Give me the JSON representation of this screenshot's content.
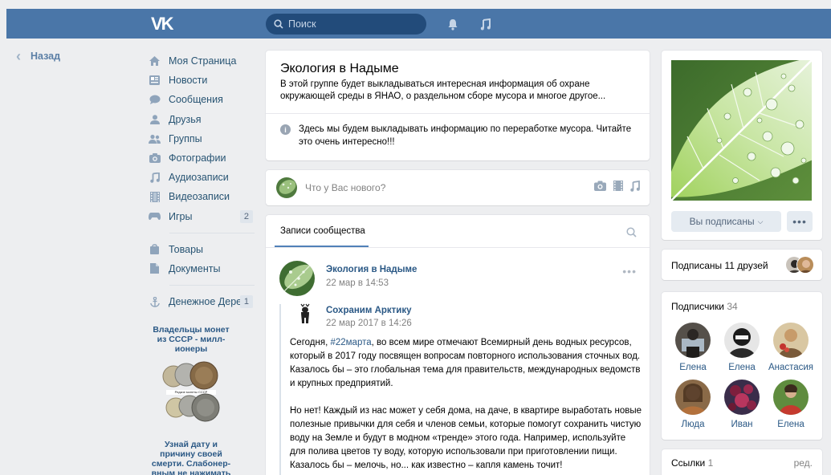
{
  "header": {
    "logo_text": "VK",
    "search_placeholder": "Поиск"
  },
  "back": {
    "label": "Назад"
  },
  "menu": {
    "items": [
      {
        "label": "Моя Страница",
        "icon": "home-icon"
      },
      {
        "label": "Новости",
        "icon": "news-icon"
      },
      {
        "label": "Сообщения",
        "icon": "messages-icon"
      },
      {
        "label": "Друзья",
        "icon": "friends-icon"
      },
      {
        "label": "Группы",
        "icon": "groups-icon"
      },
      {
        "label": "Фотографии",
        "icon": "camera-icon"
      },
      {
        "label": "Аудиозаписи",
        "icon": "music-icon"
      },
      {
        "label": "Видеозаписи",
        "icon": "film-icon"
      },
      {
        "label": "Игры",
        "icon": "gamepad-icon",
        "badge": "2"
      }
    ],
    "items2": [
      {
        "label": "Товары",
        "icon": "bag-icon"
      },
      {
        "label": "Документы",
        "icon": "document-icon"
      }
    ],
    "items3": [
      {
        "label": "Денежное Дере...",
        "icon": "anchor-icon",
        "badge": "1"
      }
    ]
  },
  "ads": {
    "ad1_title": "Владельцы монет из СССР - милл-ионеры",
    "ad1_caption": "Редкие монеты СССР",
    "ad2_title": "Узнай дату и причину своей смерти. Слабонер-вным не нажимать"
  },
  "group": {
    "title": "Экология в Надыме",
    "description": "В этой группе будет выкладываться интересная информация об охране окружающей среды в ЯНАО, о раздельном сборе мусора и многое другое...",
    "info": "Здесь мы будем выкладывать информацию по переработке мусора. Читайте это очень интересно!!!"
  },
  "composer": {
    "placeholder": "Что у Вас нового?"
  },
  "wall": {
    "tab_label": "Записи сообщества",
    "post": {
      "author": "Экология в Надыме",
      "date": "22 мар в 14:53",
      "repost_author": "Сохраним Арктику",
      "repost_date": "22 мар 2017 в 14:26",
      "p1_before": "Сегодня, ",
      "p1_tag": "#22марта",
      "p1_after": ", во всем мире отмечают Всемирный день водных ресурсов, который в 2017 году посвящен вопросам повторного использования сточных вод. Казалось бы – это глобальная тема для правительств, международных ведомств и крупных предприятий.",
      "p2": "Но нет! Каждый из нас может у себя дома, на даче, в квартире выработать новые полезные привычки для себя и членов семьи, которые помогут сохранить чистую воду на Земле и будут в модном «тренде» этого года. Например, используйте для полива цветов ту воду, которую использовали при приготовлении пищи. Казалось бы – мелочь, но... как известно – капля камень точит!"
    }
  },
  "right": {
    "subscribed_button": "Вы подписаны",
    "more_button": "•••",
    "friends_label": "Подписаны 11 друзей",
    "subs_title": "Подписчики",
    "subs_count": "34",
    "members": [
      {
        "name": "Елена"
      },
      {
        "name": "Елена"
      },
      {
        "name": "Анастасия"
      },
      {
        "name": "Люда"
      },
      {
        "name": "Иван"
      },
      {
        "name": "Елена"
      }
    ],
    "links_title": "Ссылки",
    "links_count": "1",
    "links_edit": "ред."
  },
  "colors": {
    "header": "#4a76a8",
    "link": "#2a5885",
    "page_bg": "#edeef0"
  }
}
